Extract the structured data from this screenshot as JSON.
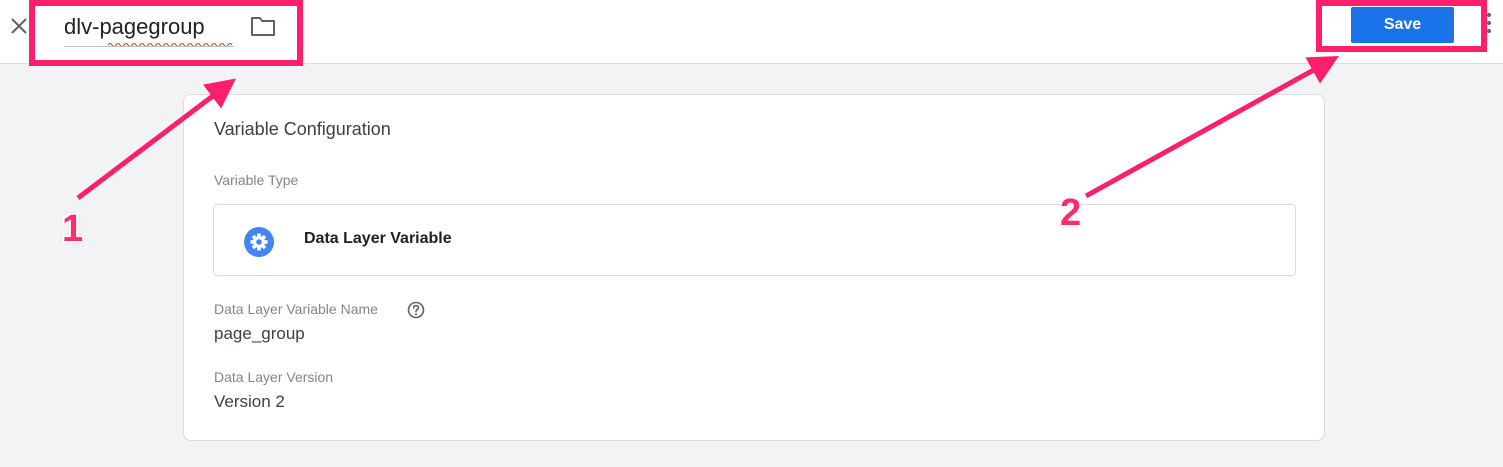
{
  "header": {
    "variable_name": "dlv-pagegroup",
    "save_label": "Save"
  },
  "card": {
    "title": "Variable Configuration",
    "variable_type_label": "Variable Type",
    "variable_type": "Data Layer Variable",
    "dlv_name_label": "Data Layer Variable Name",
    "dlv_name_value": "page_group",
    "dlv_version_label": "Data Layer Version",
    "dlv_version_value": "Version 2"
  },
  "annotations": {
    "step1": "1",
    "step2": "2",
    "color": "#ff1f6a"
  },
  "colors": {
    "primary": "#1a73e8",
    "highlight": "#ff1f6a"
  },
  "icons": [
    "close-icon",
    "folder-icon",
    "more-vert-icon",
    "settings-gear-icon",
    "help-icon"
  ]
}
